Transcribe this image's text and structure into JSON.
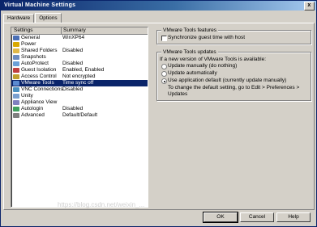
{
  "window": {
    "title": "Virtual Machine Settings",
    "close_glyph": "x"
  },
  "tabs": [
    {
      "label": "Hardware"
    },
    {
      "label": "Options"
    }
  ],
  "list": {
    "headers": {
      "settings": "Settings",
      "summary": "Summary"
    },
    "rows": [
      {
        "name": "General",
        "summary": "WinXP64",
        "icon": "general-icon",
        "color": "#4a6fb5"
      },
      {
        "name": "Power",
        "summary": "",
        "icon": "power-icon",
        "color": "#d8a800"
      },
      {
        "name": "Shared Folders",
        "summary": "Disabled",
        "icon": "folder-icon",
        "color": "#e0b848"
      },
      {
        "name": "Snapshots",
        "summary": "",
        "icon": "snapshot-icon",
        "color": "#6c8cc0"
      },
      {
        "name": "AutoProtect",
        "summary": "Disabled",
        "icon": "autoprotect-icon",
        "color": "#6aa0d8"
      },
      {
        "name": "Guest Isolation",
        "summary": "Enabled, Enabled",
        "icon": "isolation-icon",
        "color": "#c04040"
      },
      {
        "name": "Access Control",
        "summary": "Not encrypted",
        "icon": "lock-icon",
        "color": "#c0a030"
      },
      {
        "name": "VMware Tools",
        "summary": "Time sync off",
        "icon": "tools-icon",
        "color": "#5a8ad0"
      },
      {
        "name": "VNC Connections",
        "summary": "Disabled",
        "icon": "vnc-icon",
        "color": "#4a90c0"
      },
      {
        "name": "Unity",
        "summary": "",
        "icon": "unity-icon",
        "color": "#7aa0d0"
      },
      {
        "name": "Appliance View",
        "summary": "",
        "icon": "appliance-icon",
        "color": "#8080c0"
      },
      {
        "name": "Autologin",
        "summary": "Disabled",
        "icon": "autologin-icon",
        "color": "#40a060"
      },
      {
        "name": "Advanced",
        "summary": "Default/Default",
        "icon": "advanced-icon",
        "color": "#808080"
      }
    ],
    "selected_index": 7
  },
  "features": {
    "legend": "VMware Tools features",
    "sync_label": "Synchronize guest time with host",
    "sync_checked": false
  },
  "updates": {
    "legend": "VMware Tools updates",
    "prompt": "If a new version of VMware Tools is available:",
    "options": [
      {
        "label": "Update manually (do nothing)",
        "checked": false
      },
      {
        "label": "Update automatically",
        "checked": false
      },
      {
        "label": "Use application default (currently update manually)",
        "checked": true
      }
    ],
    "note_line1": "To change the default setting, go to Edit > Preferences >",
    "note_line2": "Updates"
  },
  "buttons": {
    "ok": "OK",
    "cancel": "Cancel",
    "help": "Help"
  },
  "watermark": "https://blog.csdn.net/weixin_..."
}
